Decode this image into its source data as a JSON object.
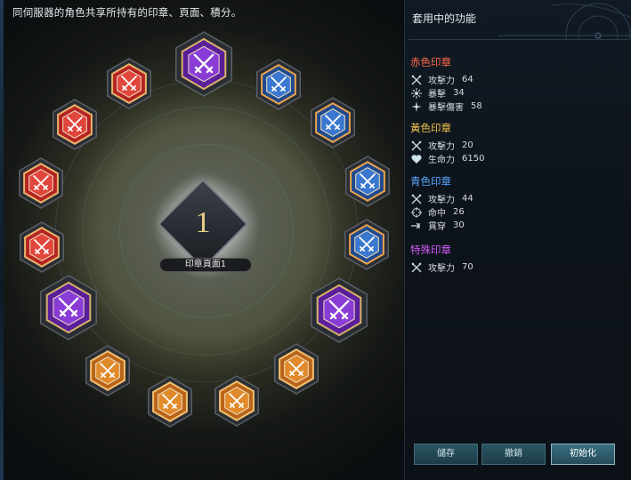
{
  "instruction": "同伺服器的角色共享所持有的印章、頁面、積分。",
  "page": {
    "number": "1",
    "label": "印章頁面1"
  },
  "seals": [
    {
      "color": "purple",
      "icon": "crossed-swords-icon",
      "size": "large"
    },
    {
      "color": "blue",
      "icon": "crossed-swords-icon",
      "size": "small"
    },
    {
      "color": "blue",
      "icon": "crossed-swords-icon",
      "size": "small"
    },
    {
      "color": "blue",
      "icon": "crossed-swords-icon",
      "size": "small"
    },
    {
      "color": "blue",
      "icon": "crossed-swords-icon",
      "size": "small"
    },
    {
      "color": "purple",
      "icon": "crossed-swords-icon",
      "size": "large"
    },
    {
      "color": "orange",
      "icon": "crossed-swords-icon",
      "size": "small"
    },
    {
      "color": "orange",
      "icon": "crossed-swords-icon",
      "size": "small"
    },
    {
      "color": "orange",
      "icon": "crossed-swords-icon",
      "size": "small"
    },
    {
      "color": "orange",
      "icon": "crossed-swords-icon",
      "size": "small"
    },
    {
      "color": "purple",
      "icon": "crossed-swords-icon",
      "size": "large"
    },
    {
      "color": "red",
      "icon": "crossed-swords-icon",
      "size": "small"
    },
    {
      "color": "red",
      "icon": "crossed-swords-icon",
      "size": "small"
    },
    {
      "color": "red",
      "icon": "crossed-swords-icon",
      "size": "small"
    },
    {
      "color": "red",
      "icon": "crossed-swords-icon",
      "size": "small"
    }
  ],
  "seal_colors": {
    "red": {
      "outer": "#b52323",
      "inner": "#e0463c",
      "rim": "#e8b46a"
    },
    "blue": {
      "outer": "#1f4a8f",
      "inner": "#3b78d0",
      "rim": "#e8a24e"
    },
    "orange": {
      "outer": "#b8641a",
      "inner": "#e08a2c",
      "rim": "#f0c070"
    },
    "purple": {
      "outer": "#5a1f9a",
      "inner": "#8a3cd6",
      "rim": "#d7b16a"
    }
  },
  "panel": {
    "title": "套用中的功能",
    "sections": [
      {
        "title": "赤色印章",
        "color": "#ff6a4a",
        "stats": [
          {
            "icon": "attack-icon",
            "name": "攻擊力",
            "value": "64"
          },
          {
            "icon": "critical-icon",
            "name": "暴擊",
            "value": "34"
          },
          {
            "icon": "critical-damage-icon",
            "name": "暴擊傷害",
            "value": "58"
          }
        ]
      },
      {
        "title": "黃色印章",
        "color": "#f2c14a",
        "stats": [
          {
            "icon": "attack-icon",
            "name": "攻擊力",
            "value": "20"
          },
          {
            "icon": "heart-icon",
            "name": "生命力",
            "value": "6150"
          }
        ]
      },
      {
        "title": "青色印章",
        "color": "#5aa7ff",
        "stats": [
          {
            "icon": "attack-icon",
            "name": "攻擊力",
            "value": "44"
          },
          {
            "icon": "crosshair-icon",
            "name": "命中",
            "value": "26"
          },
          {
            "icon": "pierce-icon",
            "name": "貫穿",
            "value": "30"
          }
        ]
      },
      {
        "title": "特殊印章",
        "color": "#d45cff",
        "stats": [
          {
            "icon": "attack-icon",
            "name": "攻擊力",
            "value": "70"
          }
        ]
      }
    ]
  },
  "buttons": {
    "save": "儲存",
    "undo": "撤銷",
    "reset": "初始化"
  }
}
